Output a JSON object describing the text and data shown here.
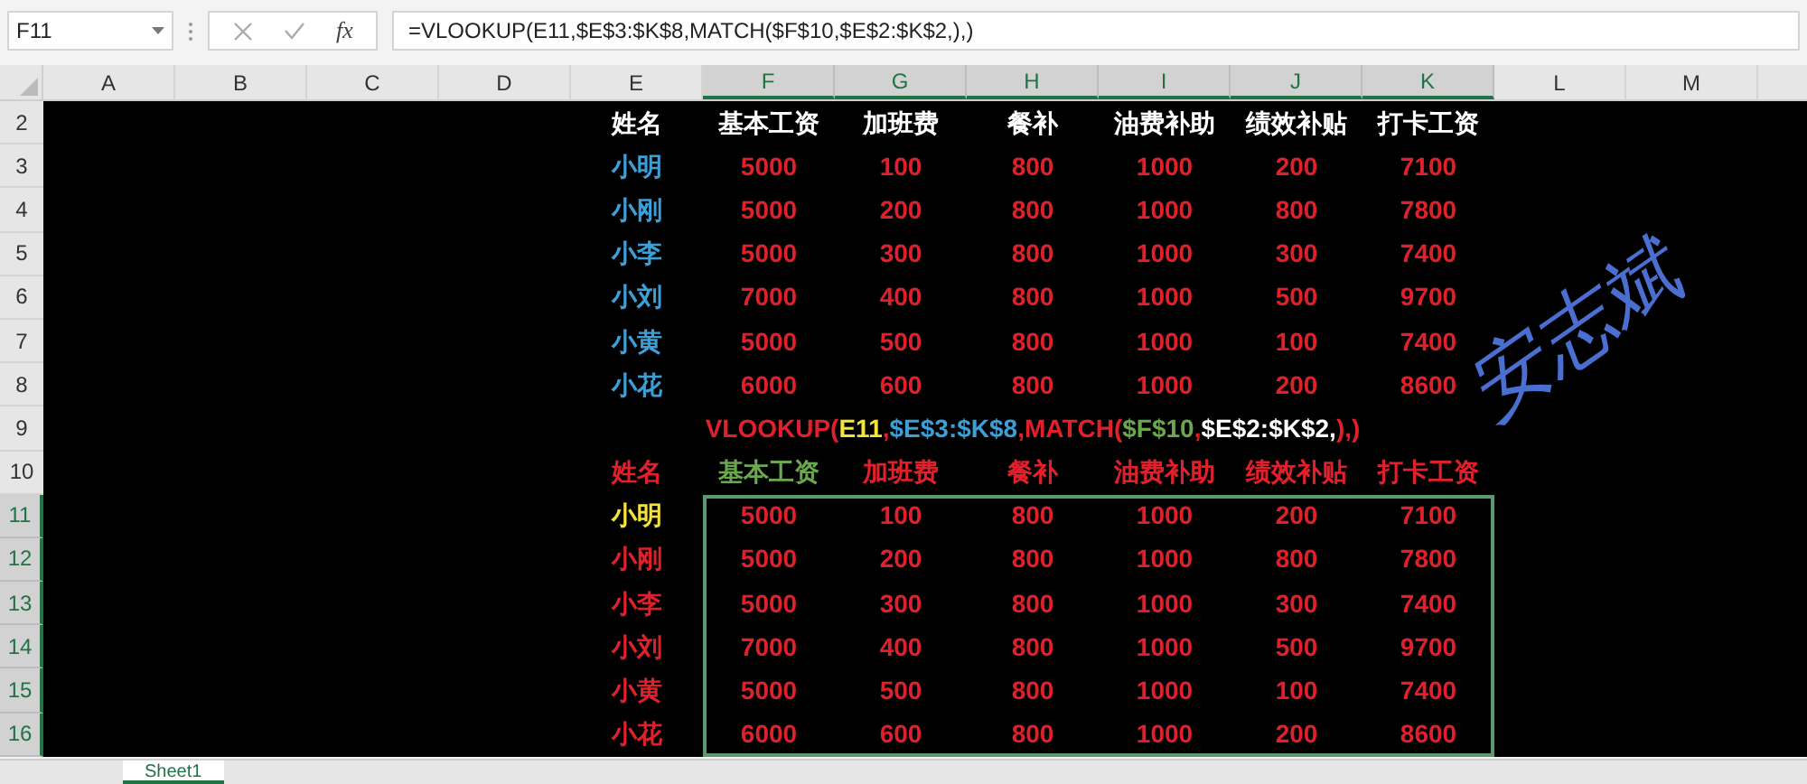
{
  "formula_bar": {
    "name_box": "F11",
    "function_label": "fx",
    "formula": "=VLOOKUP(E11,$E$3:$K$8,MATCH($F$10,$E$2:$K$2,),)"
  },
  "columns": [
    {
      "label": "A",
      "selected": false
    },
    {
      "label": "B",
      "selected": false
    },
    {
      "label": "C",
      "selected": false
    },
    {
      "label": "D",
      "selected": false
    },
    {
      "label": "E",
      "selected": false
    },
    {
      "label": "F",
      "selected": true
    },
    {
      "label": "G",
      "selected": true
    },
    {
      "label": "H",
      "selected": true
    },
    {
      "label": "I",
      "selected": true
    },
    {
      "label": "J",
      "selected": true
    },
    {
      "label": "K",
      "selected": true
    },
    {
      "label": "L",
      "selected": false
    },
    {
      "label": "M",
      "selected": false
    }
  ],
  "rows": [
    {
      "number": "2",
      "selected": false,
      "kind": "cells",
      "cells": [
        {
          "text": "姓名",
          "color": "#ffffff"
        },
        {
          "text": "基本工资",
          "color": "#ffffff"
        },
        {
          "text": "加班费",
          "color": "#ffffff"
        },
        {
          "text": "餐补",
          "color": "#ffffff"
        },
        {
          "text": "油费补助",
          "color": "#ffffff"
        },
        {
          "text": "绩效补贴",
          "color": "#ffffff"
        },
        {
          "text": "打卡工资",
          "color": "#ffffff"
        }
      ]
    },
    {
      "number": "3",
      "selected": false,
      "kind": "cells",
      "cells": [
        {
          "text": "小明",
          "color": "#3b9fd8"
        },
        {
          "text": "5000",
          "color": "#e0202a"
        },
        {
          "text": "100",
          "color": "#e0202a"
        },
        {
          "text": "800",
          "color": "#e0202a"
        },
        {
          "text": "1000",
          "color": "#e0202a"
        },
        {
          "text": "200",
          "color": "#e0202a"
        },
        {
          "text": "7100",
          "color": "#e0202a"
        }
      ]
    },
    {
      "number": "4",
      "selected": false,
      "kind": "cells",
      "cells": [
        {
          "text": "小刚",
          "color": "#3b9fd8"
        },
        {
          "text": "5000",
          "color": "#e0202a"
        },
        {
          "text": "200",
          "color": "#e0202a"
        },
        {
          "text": "800",
          "color": "#e0202a"
        },
        {
          "text": "1000",
          "color": "#e0202a"
        },
        {
          "text": "800",
          "color": "#e0202a"
        },
        {
          "text": "7800",
          "color": "#e0202a"
        }
      ]
    },
    {
      "number": "5",
      "selected": false,
      "kind": "cells",
      "cells": [
        {
          "text": "小李",
          "color": "#3b9fd8"
        },
        {
          "text": "5000",
          "color": "#e0202a"
        },
        {
          "text": "300",
          "color": "#e0202a"
        },
        {
          "text": "800",
          "color": "#e0202a"
        },
        {
          "text": "1000",
          "color": "#e0202a"
        },
        {
          "text": "300",
          "color": "#e0202a"
        },
        {
          "text": "7400",
          "color": "#e0202a"
        }
      ]
    },
    {
      "number": "6",
      "selected": false,
      "kind": "cells",
      "cells": [
        {
          "text": "小刘",
          "color": "#3b9fd8"
        },
        {
          "text": "7000",
          "color": "#e0202a"
        },
        {
          "text": "400",
          "color": "#e0202a"
        },
        {
          "text": "800",
          "color": "#e0202a"
        },
        {
          "text": "1000",
          "color": "#e0202a"
        },
        {
          "text": "500",
          "color": "#e0202a"
        },
        {
          "text": "9700",
          "color": "#e0202a"
        }
      ]
    },
    {
      "number": "7",
      "selected": false,
      "kind": "cells",
      "cells": [
        {
          "text": "小黄",
          "color": "#3b9fd8"
        },
        {
          "text": "5000",
          "color": "#e0202a"
        },
        {
          "text": "500",
          "color": "#e0202a"
        },
        {
          "text": "800",
          "color": "#e0202a"
        },
        {
          "text": "1000",
          "color": "#e0202a"
        },
        {
          "text": "100",
          "color": "#e0202a"
        },
        {
          "text": "7400",
          "color": "#e0202a"
        }
      ]
    },
    {
      "number": "8",
      "selected": false,
      "kind": "cells",
      "cells": [
        {
          "text": "小花",
          "color": "#3b9fd8"
        },
        {
          "text": "6000",
          "color": "#e0202a"
        },
        {
          "text": "600",
          "color": "#e0202a"
        },
        {
          "text": "800",
          "color": "#e0202a"
        },
        {
          "text": "1000",
          "color": "#e0202a"
        },
        {
          "text": "200",
          "color": "#e0202a"
        },
        {
          "text": "8600",
          "color": "#e0202a"
        }
      ]
    },
    {
      "number": "9",
      "selected": false,
      "kind": "formula",
      "segments": [
        {
          "text": "VLOOKUP(",
          "color": "#e0202a"
        },
        {
          "text": "E11",
          "color": "#f5e23a"
        },
        {
          "text": ",",
          "color": "#e0202a"
        },
        {
          "text": "$E$3:$K$8",
          "color": "#3b9fd8"
        },
        {
          "text": ",MATCH(",
          "color": "#e0202a"
        },
        {
          "text": "$F$10",
          "color": "#6aa84f"
        },
        {
          "text": ",",
          "color": "#e0202a"
        },
        {
          "text": "$E$2:$K$2,",
          "color": "#ffffff"
        },
        {
          "text": "),)",
          "color": "#e0202a"
        }
      ]
    },
    {
      "number": "10",
      "selected": false,
      "kind": "cells",
      "cells": [
        {
          "text": "姓名",
          "color": "#e0202a"
        },
        {
          "text": "基本工资",
          "color": "#6aa84f"
        },
        {
          "text": "加班费",
          "color": "#e0202a"
        },
        {
          "text": "餐补",
          "color": "#e0202a"
        },
        {
          "text": "油费补助",
          "color": "#e0202a"
        },
        {
          "text": "绩效补贴",
          "color": "#e0202a"
        },
        {
          "text": "打卡工资",
          "color": "#e0202a"
        }
      ]
    },
    {
      "number": "11",
      "selected": true,
      "kind": "cells",
      "cells": [
        {
          "text": "小明",
          "color": "#f5e23a"
        },
        {
          "text": "5000",
          "color": "#e0202a"
        },
        {
          "text": "100",
          "color": "#e0202a"
        },
        {
          "text": "800",
          "color": "#e0202a"
        },
        {
          "text": "1000",
          "color": "#e0202a"
        },
        {
          "text": "200",
          "color": "#e0202a"
        },
        {
          "text": "7100",
          "color": "#e0202a"
        }
      ]
    },
    {
      "number": "12",
      "selected": true,
      "kind": "cells",
      "cells": [
        {
          "text": "小刚",
          "color": "#e0202a"
        },
        {
          "text": "5000",
          "color": "#e0202a"
        },
        {
          "text": "200",
          "color": "#e0202a"
        },
        {
          "text": "800",
          "color": "#e0202a"
        },
        {
          "text": "1000",
          "color": "#e0202a"
        },
        {
          "text": "800",
          "color": "#e0202a"
        },
        {
          "text": "7800",
          "color": "#e0202a"
        }
      ]
    },
    {
      "number": "13",
      "selected": true,
      "kind": "cells",
      "cells": [
        {
          "text": "小李",
          "color": "#e0202a"
        },
        {
          "text": "5000",
          "color": "#e0202a"
        },
        {
          "text": "300",
          "color": "#e0202a"
        },
        {
          "text": "800",
          "color": "#e0202a"
        },
        {
          "text": "1000",
          "color": "#e0202a"
        },
        {
          "text": "300",
          "color": "#e0202a"
        },
        {
          "text": "7400",
          "color": "#e0202a"
        }
      ]
    },
    {
      "number": "14",
      "selected": true,
      "kind": "cells",
      "cells": [
        {
          "text": "小刘",
          "color": "#e0202a"
        },
        {
          "text": "7000",
          "color": "#e0202a"
        },
        {
          "text": "400",
          "color": "#e0202a"
        },
        {
          "text": "800",
          "color": "#e0202a"
        },
        {
          "text": "1000",
          "color": "#e0202a"
        },
        {
          "text": "500",
          "color": "#e0202a"
        },
        {
          "text": "9700",
          "color": "#e0202a"
        }
      ]
    },
    {
      "number": "15",
      "selected": true,
      "kind": "cells",
      "cells": [
        {
          "text": "小黄",
          "color": "#e0202a"
        },
        {
          "text": "5000",
          "color": "#e0202a"
        },
        {
          "text": "500",
          "color": "#e0202a"
        },
        {
          "text": "800",
          "color": "#e0202a"
        },
        {
          "text": "1000",
          "color": "#e0202a"
        },
        {
          "text": "100",
          "color": "#e0202a"
        },
        {
          "text": "7400",
          "color": "#e0202a"
        }
      ]
    },
    {
      "number": "16",
      "selected": true,
      "kind": "cells",
      "cells": [
        {
          "text": "小花",
          "color": "#e0202a"
        },
        {
          "text": "6000",
          "color": "#e0202a"
        },
        {
          "text": "600",
          "color": "#e0202a"
        },
        {
          "text": "800",
          "color": "#e0202a"
        },
        {
          "text": "1000",
          "color": "#e0202a"
        },
        {
          "text": "200",
          "color": "#e0202a"
        },
        {
          "text": "8600",
          "color": "#e0202a"
        }
      ]
    }
  ],
  "signature": {
    "text": "安志斌"
  },
  "sheet_tabs": [
    {
      "label": "Sheet1",
      "selected": true
    }
  ]
}
